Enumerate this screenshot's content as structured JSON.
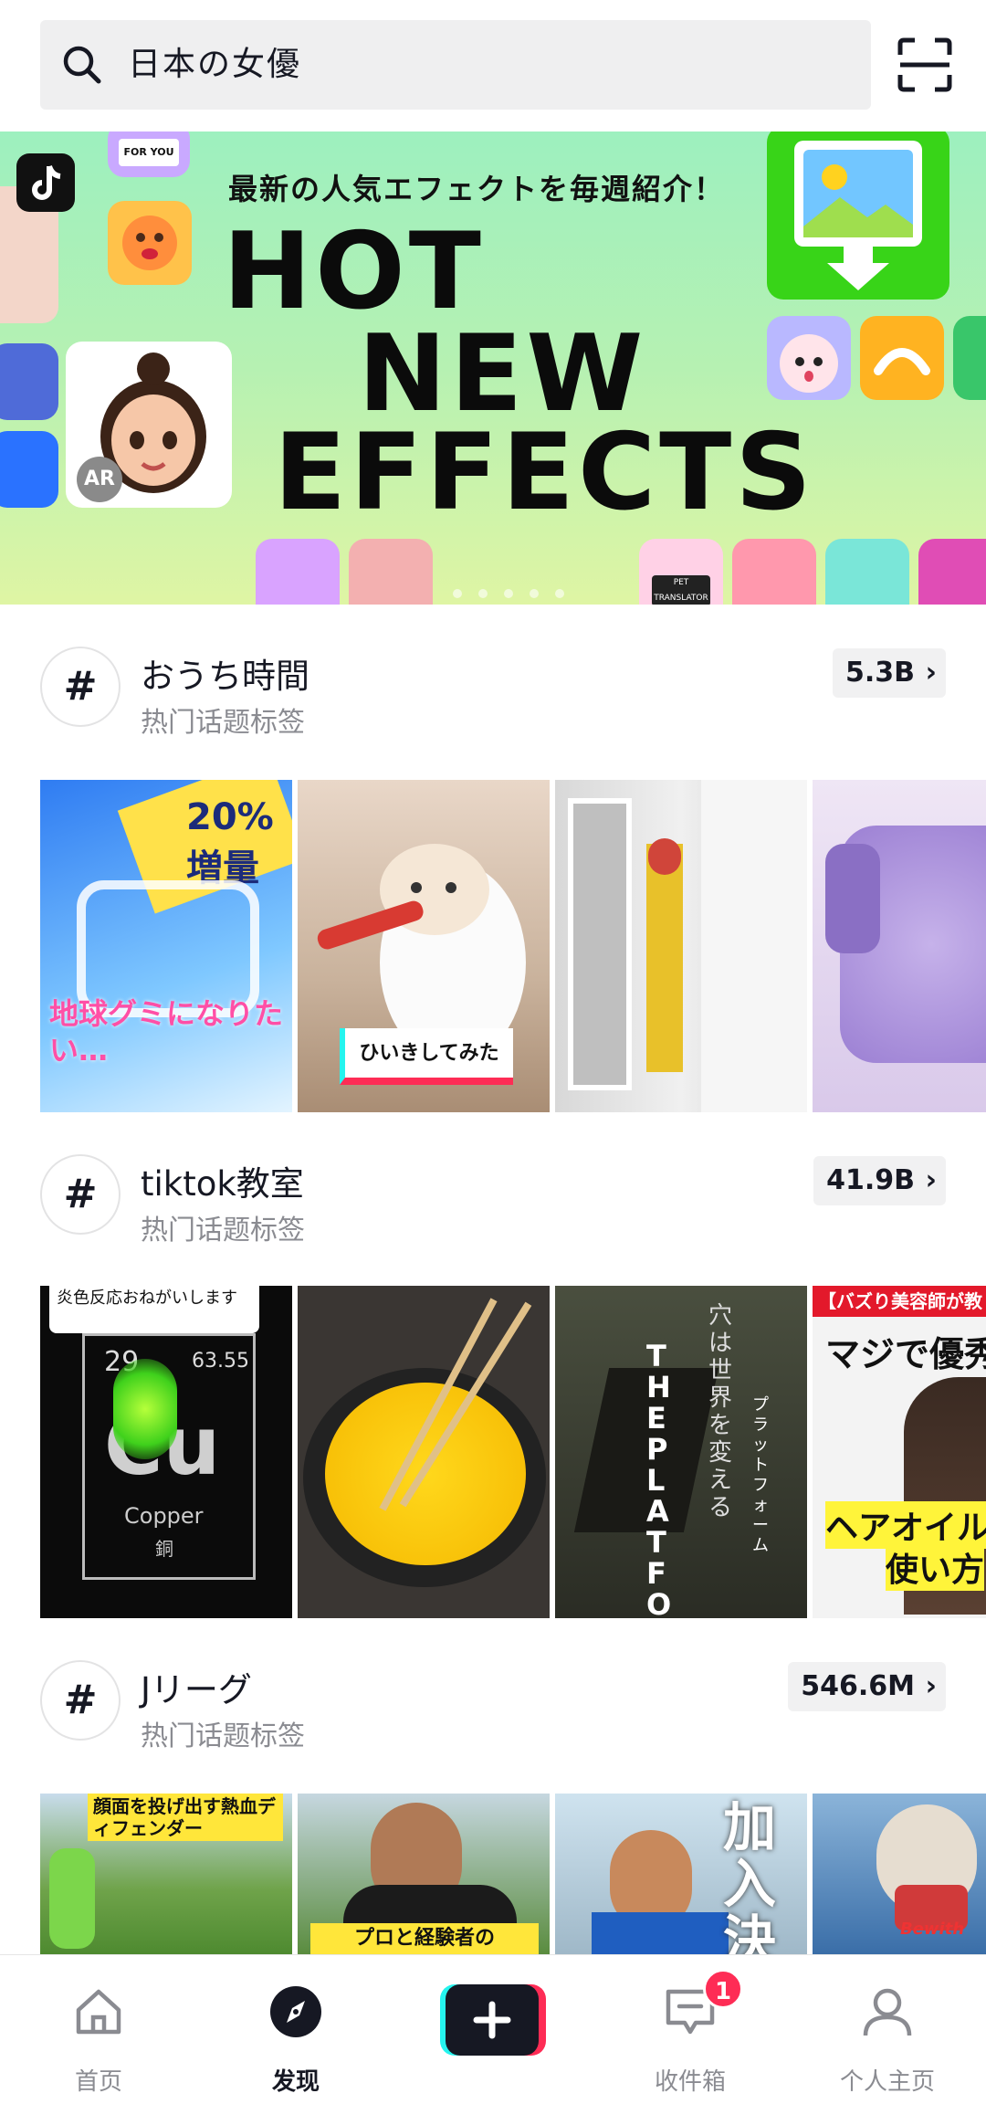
{
  "search": {
    "query": "日本の女優"
  },
  "banner": {
    "subtitle": "最新の人気エフェクトを毎週紹介！",
    "line1": "HOT",
    "line2": "NEW",
    "line3": "EFFECTS",
    "ar_label": "AR",
    "for_you_label": "FOR YOU",
    "pet_label": "PET TRANSLATOR"
  },
  "sections": [
    {
      "title": "おうち時間",
      "subtitle": "热门话题标签",
      "count": "5.3B",
      "thumbs": [
        {
          "caption": "地球グミになりたい…",
          "badge": "20%増量"
        },
        {
          "caption": "ひいきしてみた"
        },
        {
          "caption": ""
        },
        {
          "caption": ""
        }
      ]
    },
    {
      "title": "tiktok教室",
      "subtitle": "热门话题标签",
      "count": "41.9B",
      "thumbs": [
        {
          "caption": "炎色反応おねがいします",
          "element": "Cu",
          "num": "29",
          "mass": "63.55",
          "name": "Copper",
          "jp": "銅"
        },
        {
          "caption": ""
        },
        {
          "caption": "穴は世界を変える",
          "title": "THE PLATFORM",
          "sub": "プラットフォーム"
        },
        {
          "caption": "【バズり美容師が教",
          "line1": "マジで優秀",
          "line2": "ヘアオイル",
          "line3": "使い方"
        }
      ]
    },
    {
      "title": "Jリーグ",
      "subtitle": "热门话题标签",
      "count": "546.6M",
      "thumbs": [
        {
          "caption": "顔面を投げ出す熱血ディフェンダー"
        },
        {
          "caption": "プロと経験者の"
        },
        {
          "caption": "加入決"
        },
        {
          "caption": "Bewith"
        }
      ]
    }
  ],
  "tabbar": {
    "tabs": [
      {
        "label": "首页",
        "icon": "home-icon"
      },
      {
        "label": "发现",
        "icon": "compass-icon",
        "active": true
      },
      {
        "label": "",
        "icon": "create-icon"
      },
      {
        "label": "收件箱",
        "icon": "inbox-icon"
      },
      {
        "label": "个人主页",
        "icon": "profile-icon"
      }
    ],
    "inbox_badge": "1"
  },
  "colors": {
    "accent_red": "#fe2c55",
    "accent_cyan": "#25f4ee",
    "text": "#161823",
    "muted": "#8a8b91"
  }
}
